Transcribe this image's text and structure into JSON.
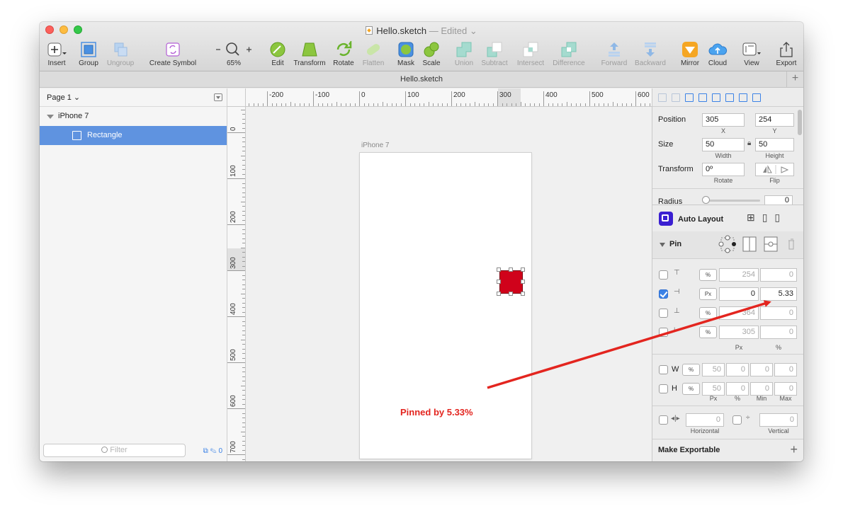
{
  "window": {
    "title": "Hello.sketch",
    "edited": "— Edited"
  },
  "toolbar": {
    "insert": "Insert",
    "group": "Group",
    "ungroup": "Ungroup",
    "create_symbol": "Create Symbol",
    "zoom": "65%",
    "edit": "Edit",
    "transform": "Transform",
    "rotate": "Rotate",
    "flatten": "Flatten",
    "mask": "Mask",
    "scale": "Scale",
    "union": "Union",
    "subtract": "Subtract",
    "intersect": "Intersect",
    "difference": "Difference",
    "forward": "Forward",
    "backward": "Backward",
    "mirror": "Mirror",
    "cloud": "Cloud",
    "view": "View",
    "export": "Export"
  },
  "tabbar": {
    "tab": "Hello.sketch",
    "add": "+"
  },
  "layers": {
    "page": "Page 1 ⌄",
    "artboard": "iPhone 7",
    "rectangle": "Rectangle",
    "filter_placeholder": "Filter",
    "filter_count": "0"
  },
  "ruler": {
    "h_labels": [
      "-200",
      "-100",
      "0",
      "100",
      "200",
      "300",
      "400",
      "500",
      "600"
    ],
    "v_labels": [
      "0",
      "100",
      "200",
      "300",
      "400",
      "500",
      "600",
      "700"
    ]
  },
  "canvas": {
    "artboard_label": "iPhone 7",
    "annotation": "Pinned by 5.33%"
  },
  "inspector": {
    "position_label": "Position",
    "x": "305",
    "y": "254",
    "x_label": "X",
    "y_label": "Y",
    "size_label": "Size",
    "width": "50",
    "height": "50",
    "width_label": "Width",
    "height_label": "Height",
    "transform_label": "Transform",
    "rotate": "0º",
    "rotate_label": "Rotate",
    "flip_label": "Flip",
    "radius_label": "Radius",
    "radius": "0",
    "auto_layout": "Auto Layout",
    "pin": "Pin",
    "pin_rows": [
      {
        "unit": "%",
        "a": "254",
        "b": "0",
        "checked": false
      },
      {
        "unit": "Px",
        "a": "0",
        "b": "5.33",
        "checked": true
      },
      {
        "unit": "%",
        "a": "364",
        "b": "0",
        "checked": false
      },
      {
        "unit": "%",
        "a": "305",
        "b": "0",
        "checked": false
      }
    ],
    "pin_px": "Px",
    "pin_pct": "%",
    "w_label": "W",
    "h_label": "H",
    "w_vals": [
      "50",
      "0",
      "0",
      "0"
    ],
    "h_vals": [
      "50",
      "0",
      "0",
      "0"
    ],
    "wh_unit": "%",
    "wh_cols": [
      "Px",
      "%",
      "Min",
      "Max"
    ],
    "spacing_h": "0",
    "spacing_v": "0",
    "horizontal": "Horizontal",
    "vertical": "Vertical",
    "make_exportable": "Make Exportable",
    "add": "+"
  },
  "colors": {
    "selection": "#5f93e0",
    "rect": "#d0021b",
    "annotation": "#e3251f",
    "accent": "#3b82e6"
  }
}
